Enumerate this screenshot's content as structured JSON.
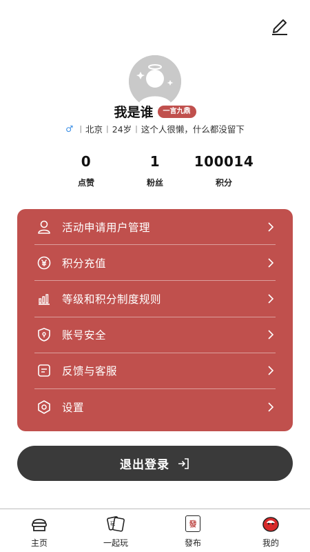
{
  "profile": {
    "name": "我是谁",
    "badge": "一言九鼎",
    "gender_symbol": "♂",
    "city": "北京",
    "age": "24岁",
    "bio": "这个人很懒，什么都没留下"
  },
  "stats": [
    {
      "value": "0",
      "label": "点赞"
    },
    {
      "value": "1",
      "label": "粉丝"
    },
    {
      "value": "100014",
      "label": "积分"
    }
  ],
  "menu": [
    {
      "label": "活动申请用户管理",
      "icon": "user-icon"
    },
    {
      "label": "积分充值",
      "icon": "yen-coin-icon"
    },
    {
      "label": "等级和积分制度规则",
      "icon": "bar-chart-icon"
    },
    {
      "label": "账号安全",
      "icon": "shield-icon"
    },
    {
      "label": "反馈与客服",
      "icon": "message-icon"
    },
    {
      "label": "设置",
      "icon": "hexagon-settings-icon"
    }
  ],
  "logout_label": "退出登录",
  "tabs": [
    {
      "label": "主页",
      "icon": "home-icon"
    },
    {
      "label": "一起玩",
      "icon": "play-together-icon"
    },
    {
      "label": "發布",
      "icon": "publish-icon",
      "icon_text": "發"
    },
    {
      "label": "我的",
      "icon": "my-profile-icon"
    }
  ],
  "colors": {
    "accent": "#c0504d",
    "dark_button": "#3a3a3a",
    "gender": "#3a8ee6"
  }
}
